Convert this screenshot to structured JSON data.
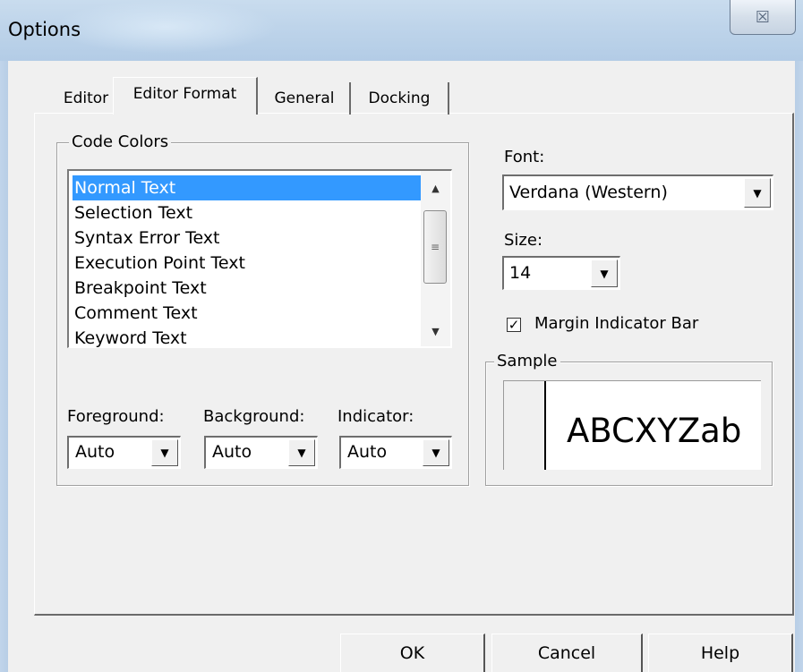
{
  "window": {
    "title": "Options",
    "close_glyph": "☒",
    "close_icon": "close-icon"
  },
  "tabs": [
    {
      "label": "Editor",
      "active": false
    },
    {
      "label": "Editor Format",
      "active": true
    },
    {
      "label": "General",
      "active": false
    },
    {
      "label": "Docking",
      "active": false
    }
  ],
  "code_colors": {
    "legend": "Code Colors",
    "items": [
      {
        "label": "Normal Text",
        "selected": true
      },
      {
        "label": "Selection Text",
        "selected": false
      },
      {
        "label": "Syntax Error Text",
        "selected": false
      },
      {
        "label": "Execution Point Text",
        "selected": false
      },
      {
        "label": "Breakpoint Text",
        "selected": false
      },
      {
        "label": "Comment Text",
        "selected": false
      },
      {
        "label": "Keyword Text",
        "selected": false
      }
    ],
    "foreground": {
      "label": "Foreground:",
      "value": "Auto"
    },
    "background": {
      "label": "Background:",
      "value": "Auto"
    },
    "indicator": {
      "label": "Indicator:",
      "value": "Auto"
    }
  },
  "font": {
    "label": "Font:",
    "value": "Verdana (Western)"
  },
  "size": {
    "label": "Size:",
    "value": "14"
  },
  "margin_indicator": {
    "label": "Margin Indicator Bar",
    "checked": true
  },
  "sample": {
    "legend": "Sample",
    "text": "ABCXYZab"
  },
  "buttons": {
    "ok": "OK",
    "cancel": "Cancel",
    "help": "Help"
  },
  "colors": {
    "selection": "#3399ff",
    "titlebar": "#bed4ea",
    "dialog": "#f0f0f0"
  }
}
